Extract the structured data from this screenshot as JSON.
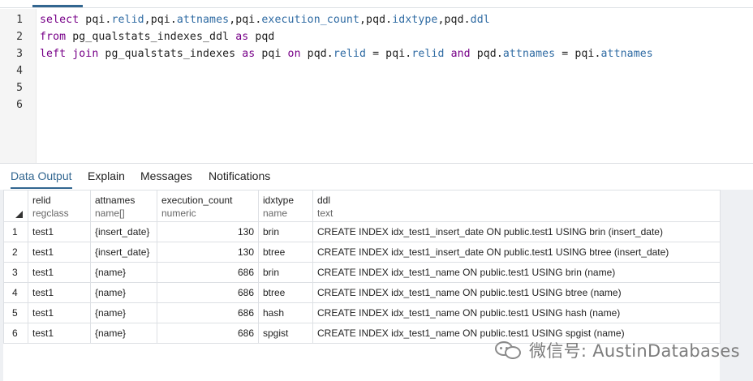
{
  "editor": {
    "line_numbers": [
      "1",
      "2",
      "3",
      "4",
      "5",
      "6"
    ],
    "lines": [
      [
        {
          "t": "select",
          "c": "kw"
        },
        {
          "t": " pqi.",
          "c": "id"
        },
        {
          "t": "relid",
          "c": "fld"
        },
        {
          "t": ",pqi.",
          "c": "id"
        },
        {
          "t": "attnames",
          "c": "fld"
        },
        {
          "t": ",pqi.",
          "c": "id"
        },
        {
          "t": "execution_count",
          "c": "fld"
        },
        {
          "t": ",pqd.",
          "c": "id"
        },
        {
          "t": "idxtype",
          "c": "fld"
        },
        {
          "t": ",pqd.",
          "c": "id"
        },
        {
          "t": "ddl",
          "c": "fld"
        }
      ],
      [
        {
          "t": "from",
          "c": "kw"
        },
        {
          "t": " pg_qualstats_indexes_ddl ",
          "c": "id"
        },
        {
          "t": "as",
          "c": "kw"
        },
        {
          "t": " pqd",
          "c": "id"
        }
      ],
      [
        {
          "t": "left join",
          "c": "kw"
        },
        {
          "t": " pg_qualstats_indexes ",
          "c": "id"
        },
        {
          "t": "as",
          "c": "kw"
        },
        {
          "t": " pqi ",
          "c": "id"
        },
        {
          "t": "on",
          "c": "kw"
        },
        {
          "t": " pqd.",
          "c": "id"
        },
        {
          "t": "relid",
          "c": "fld"
        },
        {
          "t": " = pqi.",
          "c": "id"
        },
        {
          "t": "relid",
          "c": "fld"
        },
        {
          "t": " ",
          "c": "id"
        },
        {
          "t": "and",
          "c": "kw"
        },
        {
          "t": " pqd.",
          "c": "id"
        },
        {
          "t": "attnames",
          "c": "fld"
        },
        {
          "t": " = pqi.",
          "c": "id"
        },
        {
          "t": "attnames",
          "c": "fld"
        }
      ]
    ]
  },
  "results_tabs": {
    "data_output": "Data Output",
    "explain": "Explain",
    "messages": "Messages",
    "notifications": "Notifications"
  },
  "grid": {
    "columns": [
      {
        "name": "relid",
        "type": "regclass"
      },
      {
        "name": "attnames",
        "type": "name[]"
      },
      {
        "name": "execution_count",
        "type": "numeric"
      },
      {
        "name": "idxtype",
        "type": "name"
      },
      {
        "name": "ddl",
        "type": "text"
      }
    ],
    "rows": [
      {
        "n": "1",
        "relid": "test1",
        "attnames": "{insert_date}",
        "execution_count": "130",
        "idxtype": "brin",
        "ddl": "CREATE INDEX idx_test1_insert_date ON public.test1 USING brin (insert_date)"
      },
      {
        "n": "2",
        "relid": "test1",
        "attnames": "{insert_date}",
        "execution_count": "130",
        "idxtype": "btree",
        "ddl": "CREATE INDEX idx_test1_insert_date ON public.test1 USING btree (insert_date)"
      },
      {
        "n": "3",
        "relid": "test1",
        "attnames": "{name}",
        "execution_count": "686",
        "idxtype": "brin",
        "ddl": "CREATE INDEX idx_test1_name ON public.test1 USING brin (name)"
      },
      {
        "n": "4",
        "relid": "test1",
        "attnames": "{name}",
        "execution_count": "686",
        "idxtype": "btree",
        "ddl": "CREATE INDEX idx_test1_name ON public.test1 USING btree (name)"
      },
      {
        "n": "5",
        "relid": "test1",
        "attnames": "{name}",
        "execution_count": "686",
        "idxtype": "hash",
        "ddl": "CREATE INDEX idx_test1_name ON public.test1 USING hash (name)"
      },
      {
        "n": "6",
        "relid": "test1",
        "attnames": "{name}",
        "execution_count": "686",
        "idxtype": "spgist",
        "ddl": "CREATE INDEX idx_test1_name ON public.test1 USING spgist (name)"
      }
    ]
  },
  "watermark": {
    "text": "微信号: AustinDatabases",
    "icon": "wechat-icon"
  },
  "colors": {
    "keyword": "#770088",
    "field": "#2f6ba3",
    "active_tab": "#326690"
  }
}
